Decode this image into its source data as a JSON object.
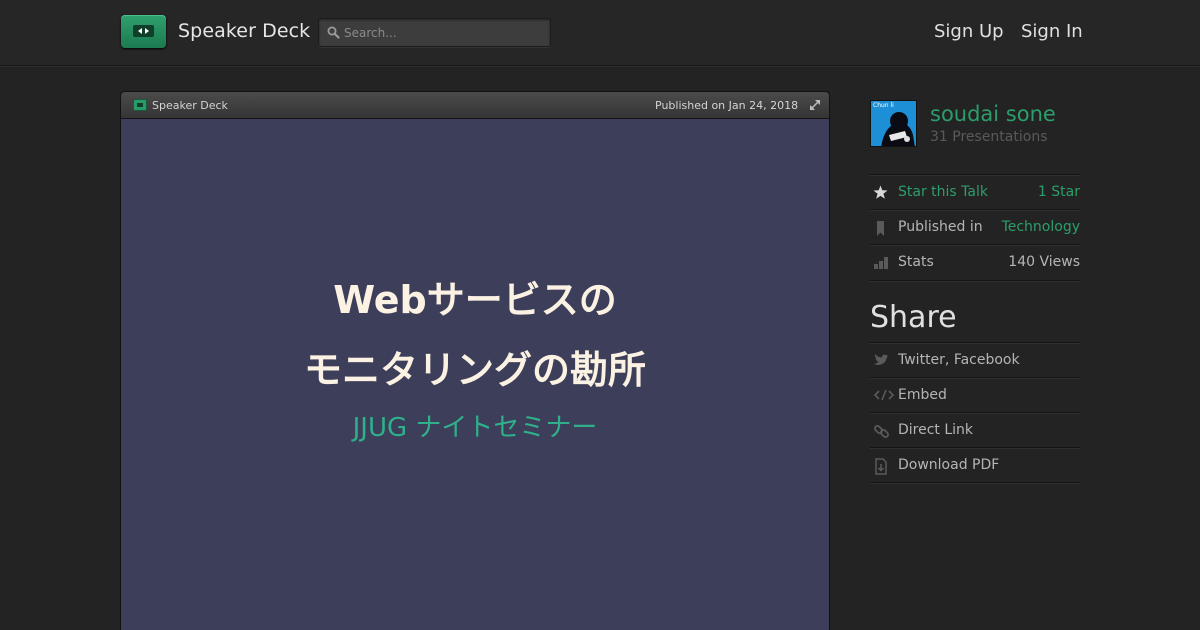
{
  "header": {
    "brand": "Speaker Deck",
    "search_placeholder": "Search...",
    "sign_up": "Sign Up",
    "sign_in": "Sign In"
  },
  "player": {
    "brand": "Speaker Deck",
    "published": "Published on Jan 24, 2018",
    "slide": {
      "title_line1": "Webサービスの",
      "title_line2": "モニタリングの勘所",
      "subtitle": "JJUG ナイトセミナー"
    }
  },
  "author": {
    "name": "soudai sone",
    "presentations": "31 Presentations",
    "avatar_caption": "Chun li"
  },
  "stats": {
    "star_label": "Star this Talk",
    "star_count": "1 Star",
    "published_label": "Published in",
    "category": "Technology",
    "stats_label": "Stats",
    "views": "140 Views"
  },
  "share": {
    "title": "Share",
    "twitter_facebook": "Twitter, Facebook",
    "embed": "Embed",
    "direct_link": "Direct Link",
    "download_pdf": "Download PDF"
  },
  "colors": {
    "accent_green": "#2c9e6b",
    "slide_bg": "#3c3e5a",
    "slide_title": "#fbf2e3",
    "slide_subtitle": "#2fb08a",
    "page_bg": "#232323"
  },
  "icons": [
    "play-logo-icon",
    "search-icon",
    "expand-icon",
    "star-icon",
    "bookmark-icon",
    "bar-chart-icon",
    "bird-icon",
    "code-icon",
    "link-icon",
    "download-icon"
  ]
}
